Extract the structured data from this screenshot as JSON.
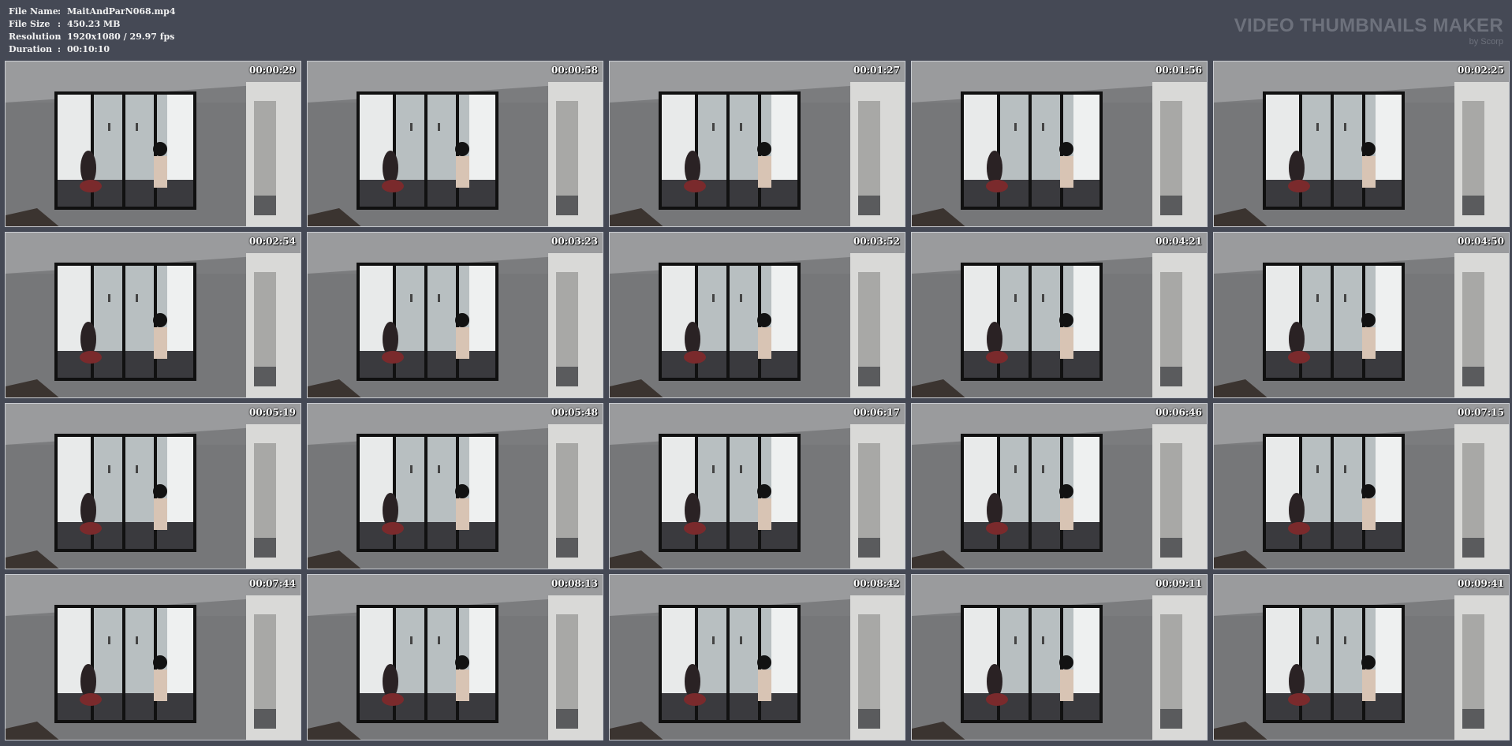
{
  "file_info": {
    "file_name_label": "File Name",
    "file_name": "MaitAndParN068.mp4",
    "file_size_label": "File Size",
    "file_size": "450.23 MB",
    "resolution_label": "Resolution",
    "resolution": "1920x1080 / 29.97 fps",
    "duration_label": "Duration",
    "duration": "00:10:10",
    "separator": ":"
  },
  "brand": {
    "title": "VIDEO THUMBNAILS MAKER",
    "byline": "by Scorp"
  },
  "thumbnails": [
    "00:00:29",
    "00:00:58",
    "00:01:27",
    "00:01:56",
    "00:02:25",
    "00:02:54",
    "00:03:23",
    "00:03:52",
    "00:04:21",
    "00:04:50",
    "00:05:19",
    "00:05:48",
    "00:06:17",
    "00:06:46",
    "00:07:15",
    "00:07:44",
    "00:08:13",
    "00:08:42",
    "00:09:11",
    "00:09:41"
  ],
  "colors": {
    "background": "#454955",
    "frame_border": "#c9ccd1",
    "brand_text": "#6d717c"
  }
}
